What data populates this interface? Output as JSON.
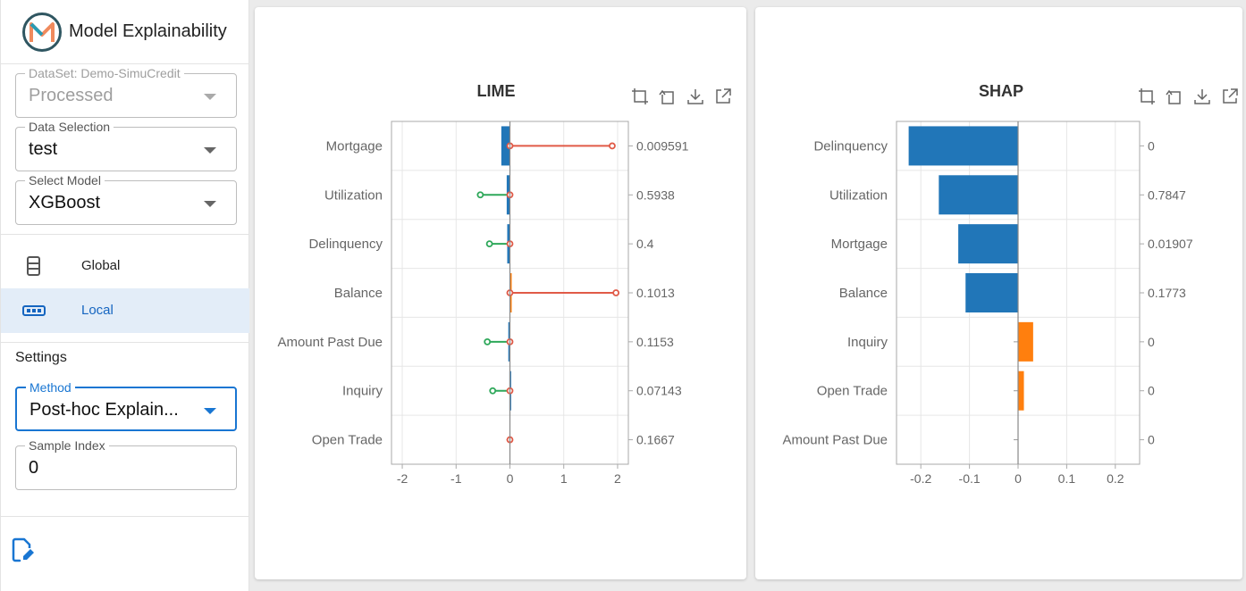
{
  "app": {
    "title": "Model Explainability"
  },
  "sidebar": {
    "dataset": {
      "label": "DataSet: Demo-SimuCredit",
      "value": "Processed"
    },
    "data_selection": {
      "label": "Data Selection",
      "value": "test"
    },
    "select_model": {
      "label": "Select Model",
      "value": "XGBoost"
    },
    "nav": [
      {
        "label": "Global",
        "icon": "list-icon",
        "selected": false
      },
      {
        "label": "Local",
        "icon": "dots-icon",
        "selected": true
      }
    ],
    "settings_heading": "Settings",
    "method": {
      "label": "Method",
      "value": "Post-hoc Explain..."
    },
    "sample_index": {
      "label": "Sample Index",
      "value": "0"
    }
  },
  "colors": {
    "accent": "#1976d2",
    "bar_blue": "#2176b8",
    "bar_orange": "#ff7f0e",
    "lime_red": "#e05a47",
    "lime_green": "#2ea85a"
  },
  "chart_data": [
    {
      "type": "bar",
      "title": "LIME",
      "categories": [
        "Mortgage",
        "Utilization",
        "Delinquency",
        "Balance",
        "Amount Past Due",
        "Inquiry",
        "Open Trade"
      ],
      "feature_values": [
        "0.009591",
        "0.5938",
        "0.4",
        "0.1013",
        "0.1153",
        "0.07143",
        "0.1667"
      ],
      "series": [
        {
          "values": [
            -0.16,
            -0.06,
            -0.05,
            0.02,
            -0.03,
            -0.01,
            0.0
          ]
        },
        {
          "values": [
            1.9,
            -0.55,
            -0.38,
            1.97,
            -0.42,
            -0.32,
            0.0
          ]
        }
      ],
      "xlim": [
        -2.2,
        2.2
      ],
      "xticks": [
        "-2",
        "-1",
        "0",
        "1",
        "2"
      ],
      "grid": true
    },
    {
      "type": "bar",
      "title": "SHAP",
      "categories": [
        "Delinquency",
        "Utilization",
        "Mortgage",
        "Balance",
        "Inquiry",
        "Open Trade",
        "Amount Past Due"
      ],
      "feature_values": [
        "0",
        "0.7847",
        "0.01907",
        "0.1773",
        "0",
        "0",
        "0"
      ],
      "values": [
        -0.225,
        -0.163,
        -0.123,
        -0.108,
        0.031,
        0.012,
        0.0
      ],
      "xlim": [
        -0.25,
        0.25
      ],
      "xticks": [
        "-0.2",
        "-0.1",
        "0",
        "0.1",
        "0.2"
      ],
      "grid": true
    }
  ]
}
